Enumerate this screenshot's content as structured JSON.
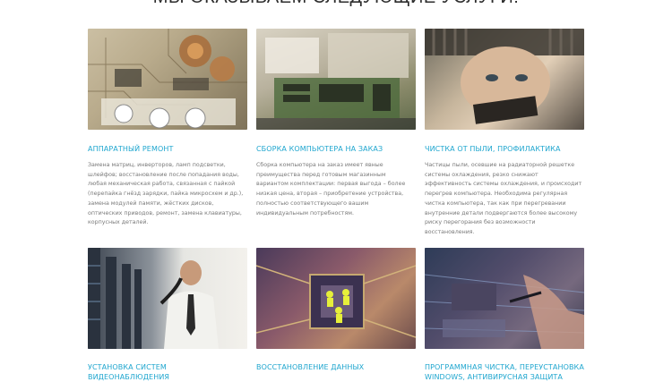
{
  "section": {
    "heading": "МЫ ОКАЗЫВАЕМ СЛЕДУЮЩИЕ УСЛУГИ:"
  },
  "services": [
    {
      "title": "АППАРАТНЫЙ РЕМОНТ",
      "description": "Замена матриц, инверторов, ламп подсветки, шлейфов; восстановление после попадания воды, любая механическая работа, связанная с пайкой (перепайка гнёзд зарядки, пайка микросхем и др.), замена модулей памяти, жёстких дисков, оптических приводов, ремонт, замена клавиатуры, корпусных деталей."
    },
    {
      "title": "СБОРКА КОМПЬЮТЕРА НА ЗАКАЗ",
      "description": "Сборка компьютера на заказ имеет явные преимущества перед готовым магазинным вариантом комплектации: первая выгода – более низкая цена, вторая – приобретение устройства, полностью соответствующего вашим индивидуальным потребностям."
    },
    {
      "title": "ЧИСТКА ОТ ПЫЛИ, ПРОФИЛАКТИКА",
      "description": "Частицы пыли, осевшие на радиаторной решетке системы охлаждения, резко снижают эффективность системы охлаждения, и происходит перегрев компьютера. Необходима регулярная чистка компьютера, так как при перегревании внутренние детали подвергаются более высокому риску перегорания без возможности восстановления."
    },
    {
      "title": "УСТАНОВКА СИСТЕМ ВИДЕОНАБЛЮДЕНИЯ",
      "description": ""
    },
    {
      "title": "ВОССТАНОВЛЕНИЕ ДАННЫХ",
      "description": ""
    },
    {
      "title": "ПРОГРАММНАЯ ЧИСТКА, ПЕРЕУСТАНОВКА WINDOWS, АНТИВИРУСНАЯ ЗАЩИТА",
      "description": ""
    }
  ],
  "colors": {
    "title": "#1fa6cf",
    "text": "#7a7a7a",
    "heading": "#2d2d2d"
  }
}
